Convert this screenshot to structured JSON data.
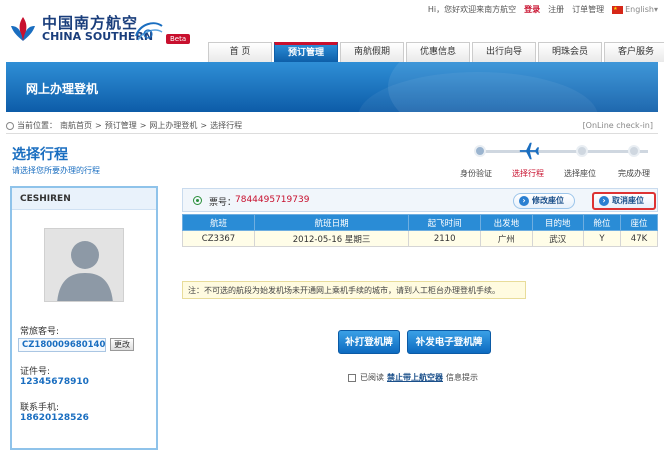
{
  "header": {
    "logo_cn": "中国南方航空",
    "logo_en": "CHINA SOUTHERN",
    "beta": "Beta",
    "toplinks": {
      "greeting": "Hi，您好欢迎来南方航空",
      "login": "登录",
      "register": "注册",
      "orders": "订单管理",
      "language": "English"
    }
  },
  "nav": {
    "items": [
      {
        "label": "首 页"
      },
      {
        "label": "预订管理"
      },
      {
        "label": "南航假期"
      },
      {
        "label": "优惠信息"
      },
      {
        "label": "出行向导"
      },
      {
        "label": "明珠会员"
      },
      {
        "label": "客户服务"
      }
    ],
    "active_index": 1
  },
  "banner": {
    "title": "网上办理登机"
  },
  "breadcrumb": {
    "prefix": "当前位置：",
    "items": [
      "南航首页",
      "预订管理",
      "网上办理登机",
      "选择行程"
    ],
    "separator": ">",
    "online": "[OnLine check-in]"
  },
  "page": {
    "title": "选择行程",
    "subtitle": "请选择您所要办理的行程"
  },
  "steps": {
    "items": [
      "身份验证",
      "选择行程",
      "选择座位",
      "完成办理"
    ],
    "current": 1
  },
  "passenger": {
    "name": "CESHIREN",
    "ffp_label": "常旅客号:",
    "ffp_value": "CZ180009680140",
    "change_label": "更改",
    "id_label": "证件号:",
    "id_value": "12345678910",
    "phone_label": "联系手机:",
    "phone_value": "18620128526"
  },
  "ticket": {
    "label": "票号：",
    "number": "7844495719739",
    "modify_label": "修改座位",
    "cancel_label": "取消座位"
  },
  "flights": {
    "headers": [
      "航班",
      "航班日期",
      "起飞时间",
      "出发地",
      "目的地",
      "舱位",
      "座位"
    ],
    "rows": [
      [
        "CZ3367",
        "2012-05-16 星期三",
        "2110",
        "广州",
        "武汉",
        "Y",
        "47K"
      ]
    ]
  },
  "notice": "注：不可选的航段为始发机场未开通网上乘机手续的城市，请到人工柜台办理登机手续。",
  "actions": {
    "reprint_label": "补打登机牌",
    "reissue_label": "补发电子登机牌"
  },
  "agreement": {
    "prefix": "已阅读",
    "link": "禁止带上航空器",
    "suffix": "信息提示"
  },
  "colors": {
    "brand_blue": "#1a6ec0",
    "accent_red": "#c8102e"
  }
}
